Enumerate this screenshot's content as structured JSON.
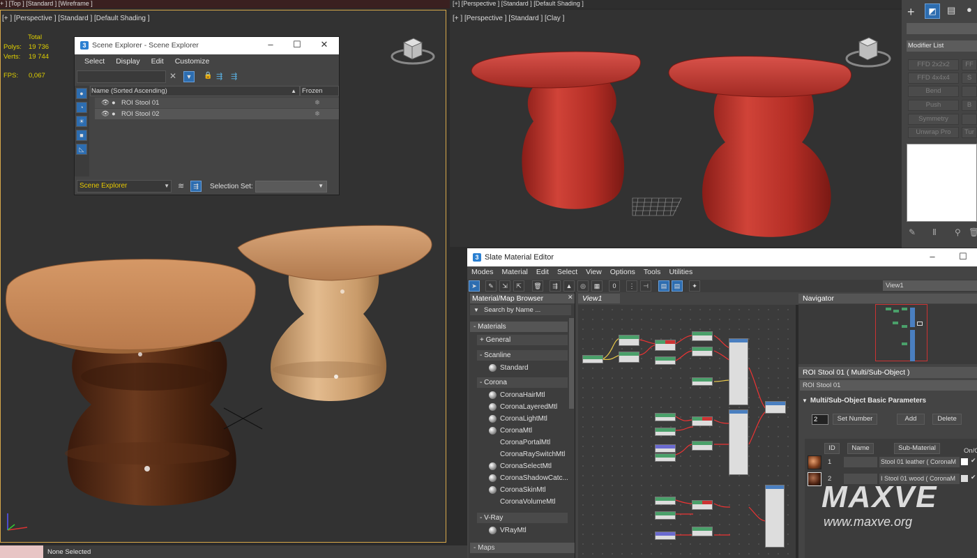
{
  "top_viewport_label": "+ ] [Top ] [Standard ] [Wireframe ]",
  "top_right_viewport_label": "[+] [Perspective ] [Standard ] [Default Shading ]",
  "left_viewport": {
    "label": "[+ ] [Perspective ] [Standard ] [Default Shading ]",
    "stats": {
      "total_label": "Total",
      "polys_label": "Polys:",
      "polys_value": "19 736",
      "verts_label": "Verts:",
      "verts_value": "19 744",
      "fps_label": "FPS:",
      "fps_value": "0,067"
    },
    "stool_left_wood": "#5a2e18",
    "stool_right_wood": "#d6a777",
    "seat_color": "#c98a5c"
  },
  "right_viewport": {
    "label": "[+ ] [Perspective ] [Standard ] [Clay ]",
    "clay_color": "#c2362e"
  },
  "scene_explorer": {
    "title": "Scene Explorer - Scene Explorer",
    "menu": [
      "Select",
      "Display",
      "Edit",
      "Customize"
    ],
    "col_name": "Name (Sorted Ascending)",
    "col_frozen": "Frozen",
    "rows": [
      "ROI Stool 01",
      "ROI Stool 02"
    ],
    "footer_dropdown": "Scene Explorer",
    "selection_set_label": "Selection Set:"
  },
  "command_panel": {
    "modifier_list": "Modifier List",
    "buttons": [
      "FFD 2x2x2",
      "FFD 4x4x4",
      "Bend",
      "Push",
      "Symmetry",
      "Unwrap Pro"
    ],
    "buttons_right": [
      "FF",
      "S",
      "",
      "B",
      "",
      "Tur"
    ]
  },
  "slate": {
    "title": "Slate Material Editor",
    "menu": [
      "Modes",
      "Material",
      "Edit",
      "Select",
      "View",
      "Options",
      "Tools",
      "Utilities"
    ],
    "view_dropdown": "View1",
    "browser_title": "Material/Map Browser",
    "search_placeholder": "Search by Name ...",
    "view_tab": "View1",
    "materials_header": "- Materials",
    "general_header": "+ General",
    "scanline_header": "- Scanline",
    "scanline_items": [
      "Standard"
    ],
    "corona_header": "- Corona",
    "corona_items": [
      "CoronaHairMtl",
      "CoronaLayeredMtl",
      "CoronaLightMtl",
      "CoronaMtl",
      "CoronaPortalMtl",
      "CoronaRaySwitchMtl",
      "CoronaSelectMtl",
      "CoronaShadowCatc...",
      "CoronaSkinMtl",
      "CoronaVolumeMtl"
    ],
    "vray_header": "- V-Ray",
    "vray_items": [
      "VRayMtl"
    ],
    "maps_header": "- Maps",
    "navigator_title": "Navigator",
    "param_title": "ROI Stool 01  ( Multi/Sub-Object )",
    "param_name": "ROI Stool 01",
    "rollout_title": "Multi/Sub-Object Basic Parameters",
    "count_value": "2",
    "set_number": "Set Number",
    "add": "Add",
    "delete": "Delete",
    "col_id": "ID",
    "col_name": "Name",
    "col_submaterial": "Sub-Material",
    "col_onoff": "On/O",
    "sub_rows": [
      {
        "id": "1",
        "material": "Stool 01 leather  ( CoronaM"
      },
      {
        "id": "2",
        "material": "I Stool 01 wood  ( CoronaM"
      }
    ]
  },
  "status": {
    "selection": "None Selected"
  },
  "watermark": {
    "brand": "MAXVE",
    "url": "www.maxve.org"
  }
}
